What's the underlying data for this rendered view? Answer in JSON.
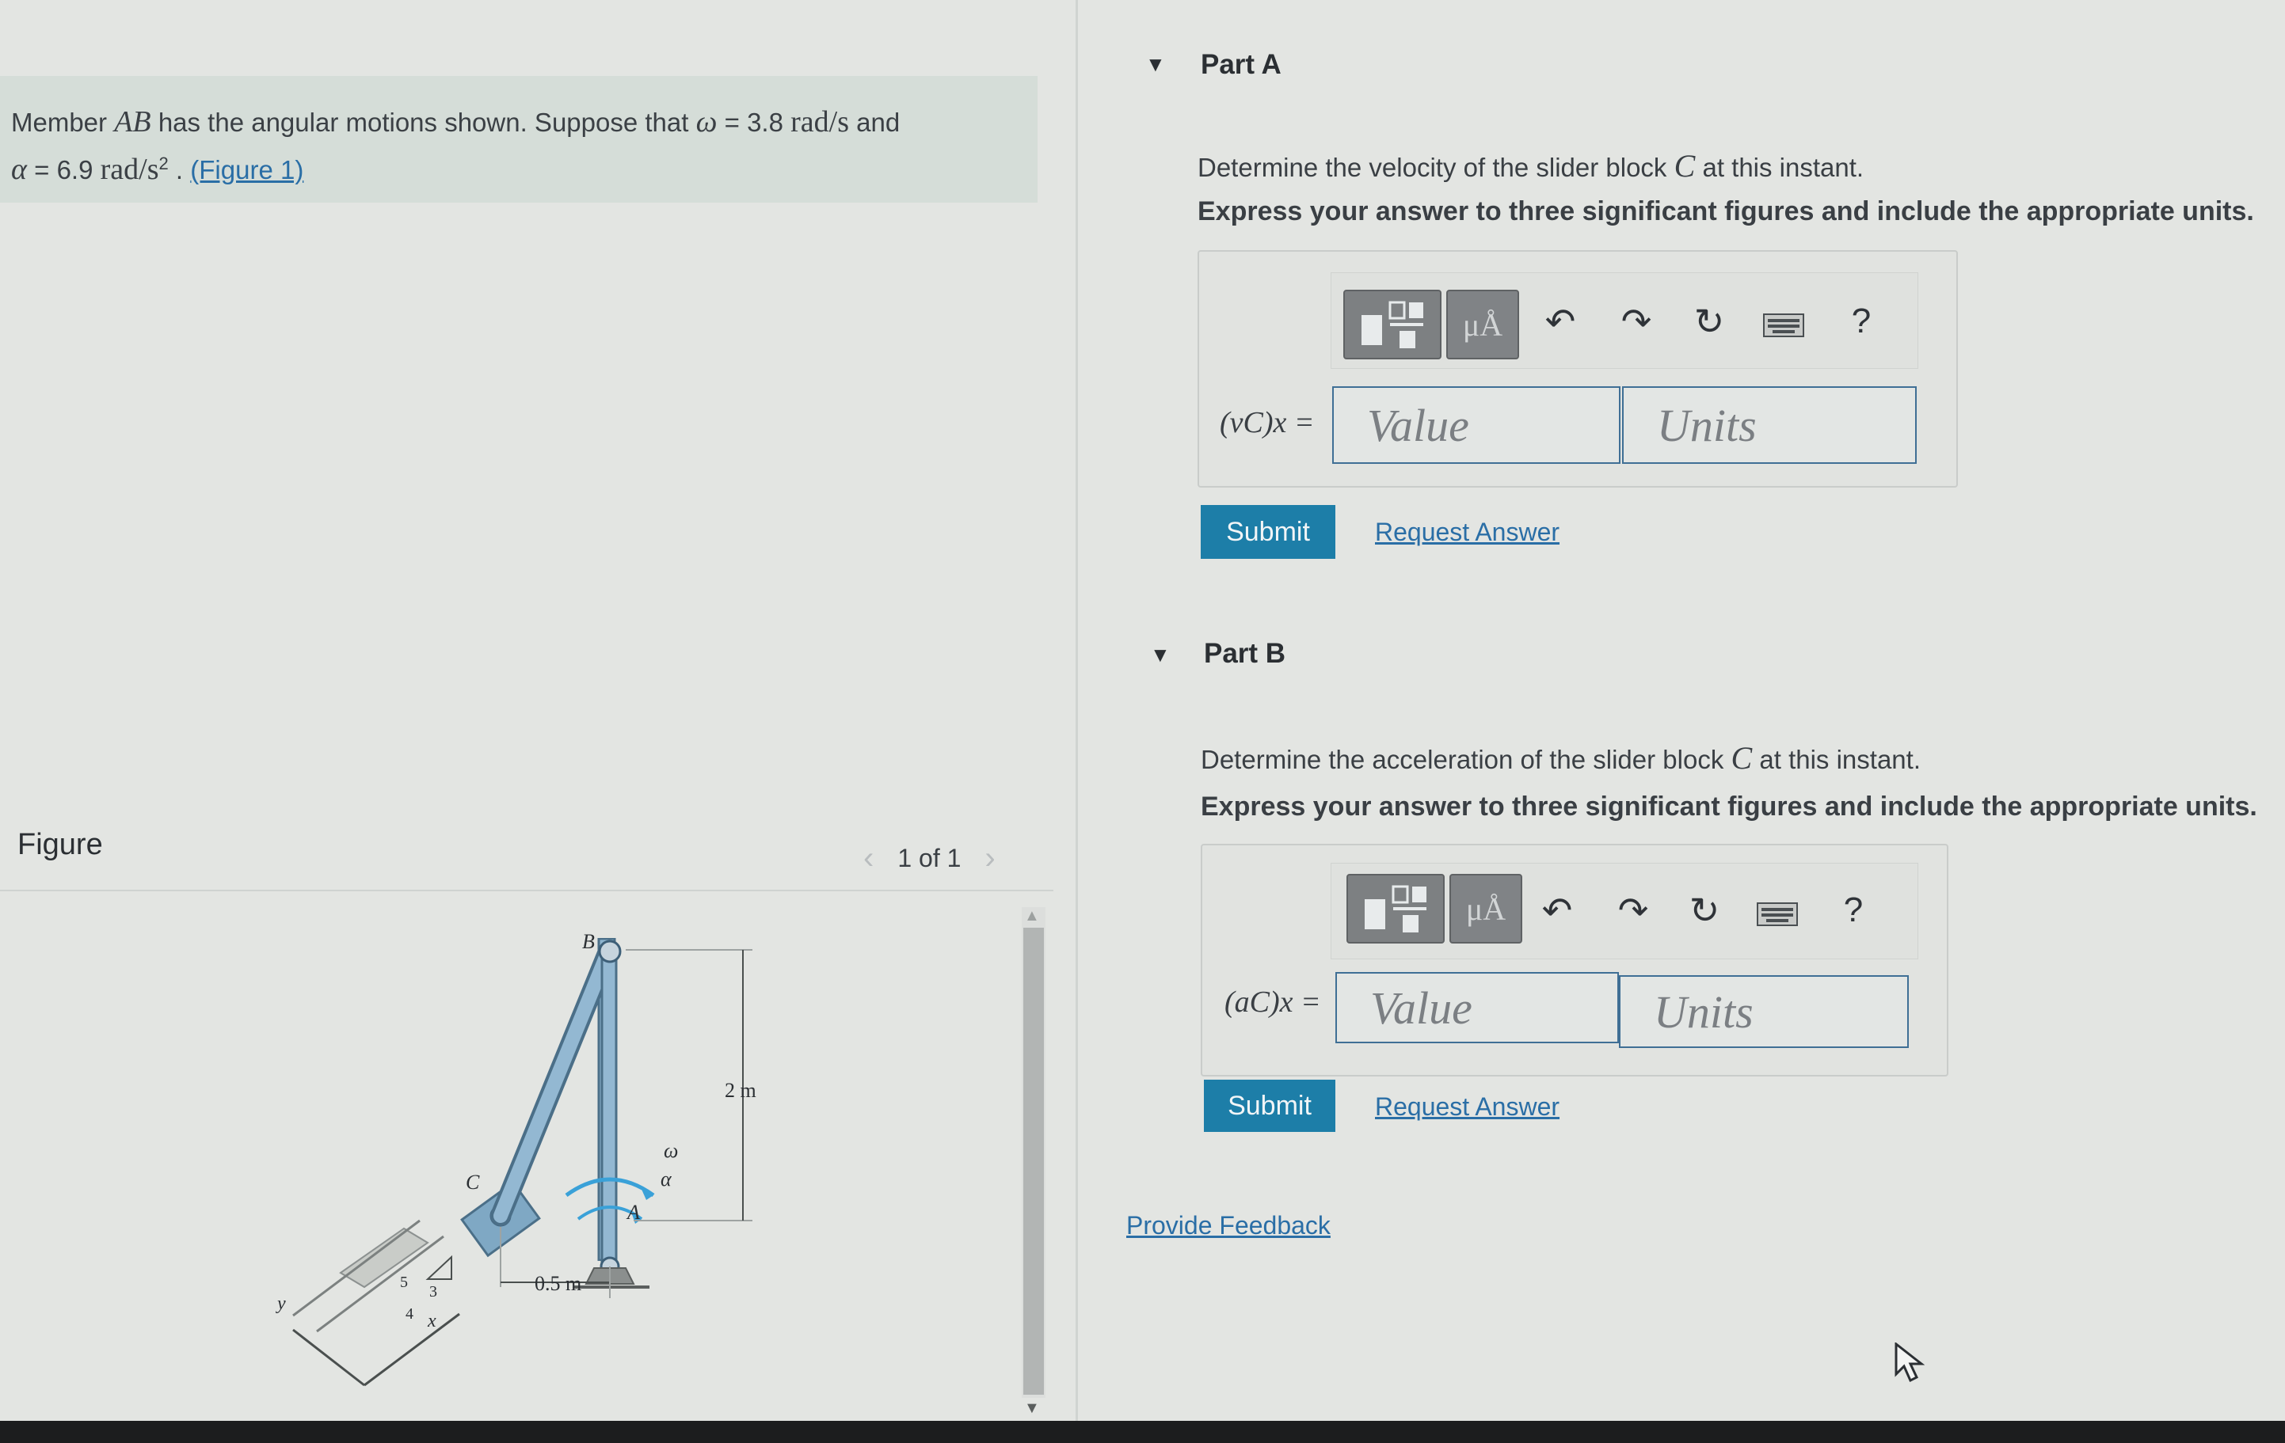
{
  "problem": {
    "text_pre": "Member",
    "member": "AB",
    "text_mid": "has the angular motions shown. Suppose that",
    "omega_sym": "ω",
    "eq": "=",
    "omega_val": "3.8",
    "omega_unit": "rad/s",
    "and": "and",
    "alpha_sym": "α",
    "alpha_val": "6.9",
    "alpha_unit": "rad/s",
    "alpha_exp": "2",
    "sep": ".",
    "figure_link": "(Figure 1)"
  },
  "figure": {
    "title": "Figure",
    "pager": "1 of 1",
    "prev": "‹",
    "next": "›",
    "labels": {
      "B": "B",
      "C": "C",
      "A": "A",
      "omega": "ω",
      "alpha": "α",
      "height": "2 m",
      "width": "0.5 m",
      "s5": "5",
      "s3": "3",
      "s4": "4",
      "x": "x",
      "y": "y"
    }
  },
  "partA": {
    "toggle": "▼",
    "title": "Part A",
    "question_pre": "Determine the velocity of the slider block",
    "block": "C",
    "question_post": "at this instant.",
    "instruction": "Express your answer to three significant figures and include the appropriate units.",
    "var_label": "(vC)x =",
    "value_placeholder": "Value",
    "units_placeholder": "Units",
    "submit": "Submit",
    "request": "Request Answer"
  },
  "partB": {
    "toggle": "▼",
    "title": "Part B",
    "question_pre": "Determine the acceleration of the slider block",
    "block": "C",
    "question_post": "at this instant.",
    "instruction": "Express your answer to three significant figures and include the appropriate units.",
    "var_label": "(aC)x =",
    "value_placeholder": "Value",
    "units_placeholder": "Units",
    "submit": "Submit",
    "request": "Request Answer"
  },
  "toolbar": {
    "units_btn": "μÅ",
    "help": "?",
    "undo": "↶",
    "redo": "↷",
    "reset": "↻"
  },
  "feedback": "Provide Feedback"
}
